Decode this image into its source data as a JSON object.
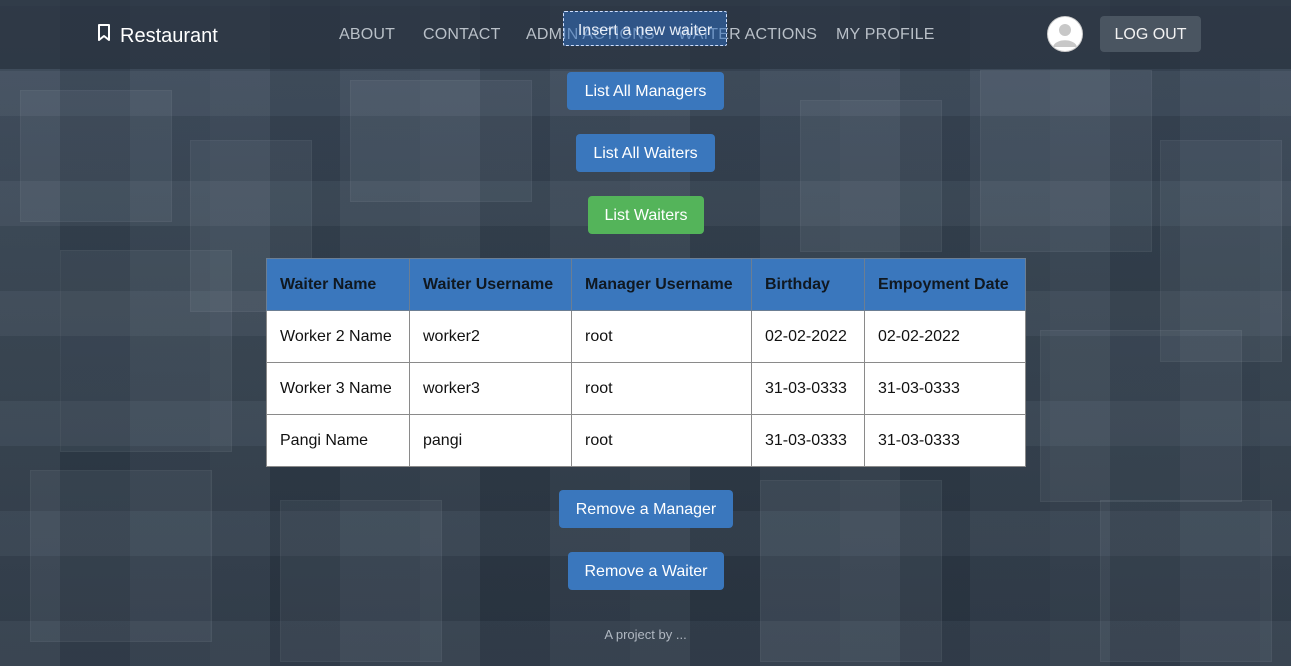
{
  "navbar": {
    "brand": "Restaurant",
    "links": [
      "ABOUT",
      "CONTACT",
      "ADMIN ACTIONS",
      "WAITER ACTIONS",
      "MY PROFILE"
    ],
    "logout_label": "LOG OUT",
    "avatar_icon": "user-avatar-icon",
    "brand_icon": "bookmark-icon"
  },
  "actions": {
    "insert_waiter": "Insert a new waiter",
    "list_managers": "List All Managers",
    "list_all_waiters": "List All Waiters",
    "list_waiters": "List Waiters",
    "remove_manager": "Remove a Manager",
    "remove_waiter": "Remove a Waiter"
  },
  "table": {
    "headers": [
      "Waiter Name",
      "Waiter Username",
      "Manager Username",
      "Birthday",
      "Empoyment Date"
    ],
    "rows": [
      [
        "Worker 2 Name",
        "worker2",
        "root",
        "02-02-2022",
        "02-02-2022"
      ],
      [
        "Worker 3 Name",
        "worker3",
        "root",
        "31-03-0333",
        "31-03-0333"
      ],
      [
        "Pangi Name",
        "pangi",
        "root",
        "31-03-0333",
        "31-03-0333"
      ]
    ]
  },
  "footer": "A project by ...",
  "colors": {
    "primary": "#3a77bd",
    "success": "#54b45a",
    "navbar": "#28323e"
  }
}
